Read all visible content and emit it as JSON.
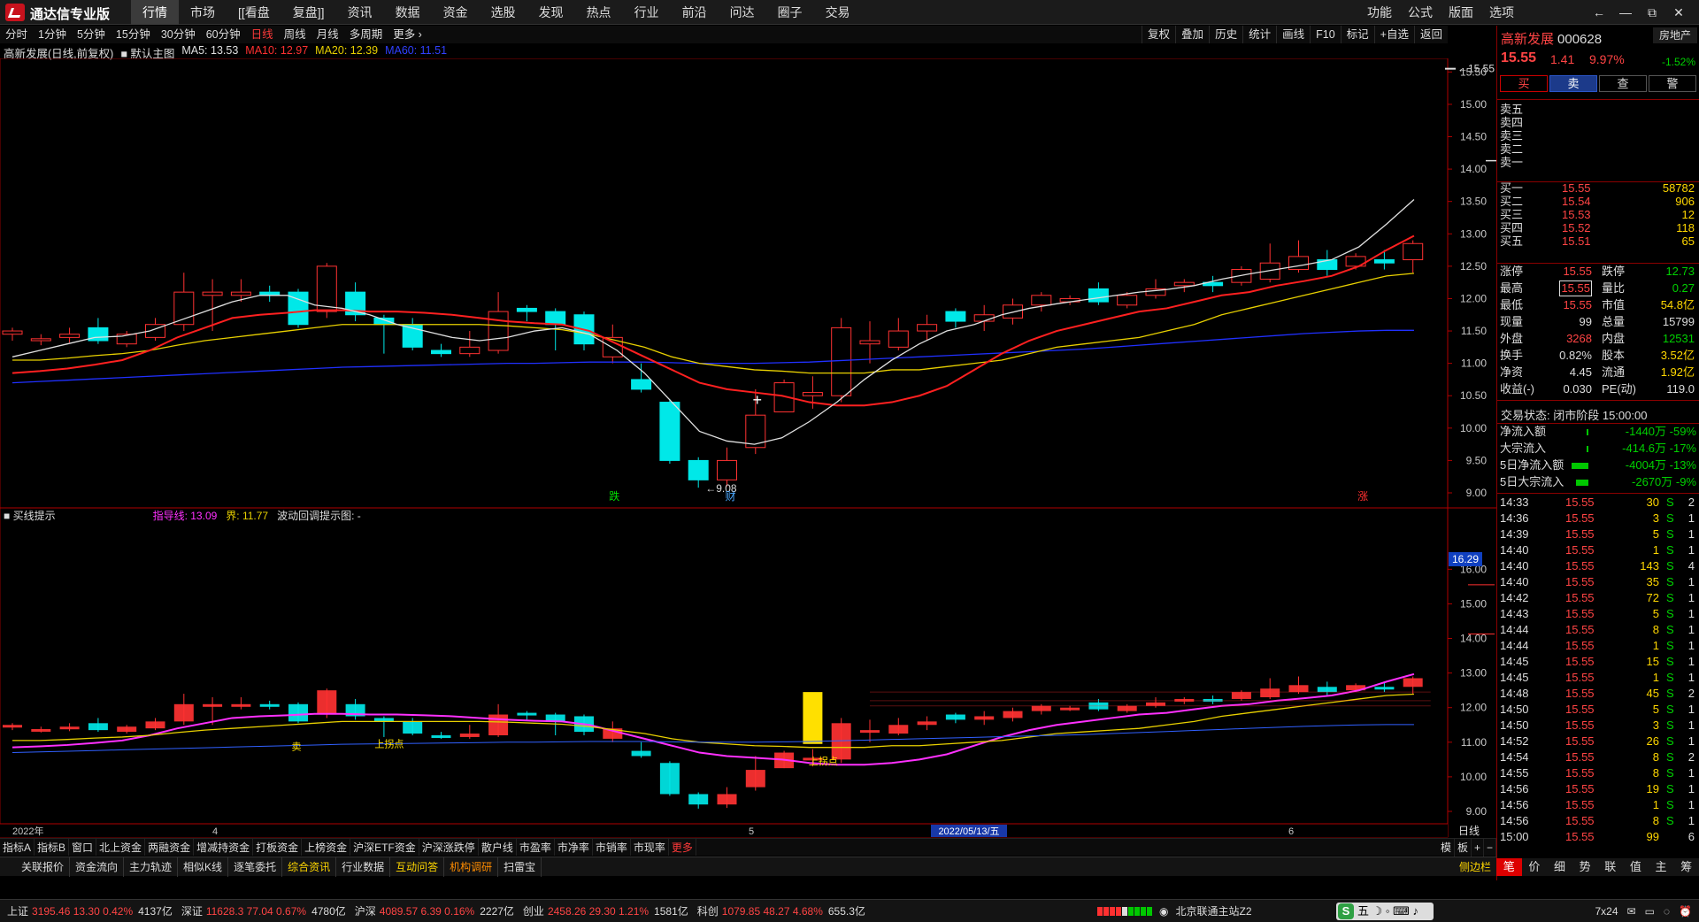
{
  "app": {
    "title": "通达信专业版"
  },
  "menu": [
    "行情",
    "市场",
    "[[看盘",
    "复盘]]",
    "资讯",
    "数据",
    "资金",
    "选股",
    "发现",
    "热点",
    "行业",
    "前沿",
    "问达",
    "圈子",
    "交易"
  ],
  "right_menu": [
    "功能",
    "公式",
    "版面",
    "选项"
  ],
  "window_controls": [
    "←",
    "—",
    "⧉",
    "✕"
  ],
  "periods": [
    "分时",
    "1分钟",
    "5分钟",
    "15分钟",
    "30分钟",
    "60分钟",
    "日线",
    "周线",
    "月线",
    "多周期",
    "更多 ›"
  ],
  "active_period": "日线",
  "chart_tools": [
    "复权",
    "叠加",
    "历史",
    "统计",
    "画线",
    "F10",
    "标记",
    "+自选",
    "返回"
  ],
  "info": {
    "name": "高新发展(日线,前复权)",
    "main": "■ 默认主图",
    "ma5": "MA5: 13.53",
    "ma10": "MA10: 12.97",
    "ma20": "MA20: 12.39",
    "ma60": "MA60: 11.51"
  },
  "indicator": {
    "name": "■ 买线提示",
    "guide": "指导线: 13.09",
    "bound": "界: 11.77",
    "wave": "波动回调提示图: -"
  },
  "chart_data": {
    "type": "candlestick",
    "title": "高新发展(日线,前复权)",
    "price_axis": {
      "ylim": [
        9.0,
        15.6
      ],
      "ticks": [
        "15.50",
        "15.00",
        "14.50",
        "14.00",
        "13.50",
        "13.00",
        "12.50",
        "12.00",
        "11.50",
        "11.00",
        "10.50",
        "10.00",
        "9.50",
        "9.00"
      ]
    },
    "indicator_axis": {
      "ylim": [
        9.0,
        16.29
      ],
      "ticks": [
        "16.00",
        "15.00",
        "14.00",
        "13.00",
        "12.00",
        "11.00",
        "10.00",
        "9.00"
      ],
      "current_label": "16.29"
    },
    "candles": [
      [
        11.45,
        11.5,
        11.35,
        11.55
      ],
      [
        11.35,
        11.38,
        11.28,
        11.45
      ],
      [
        11.4,
        11.45,
        11.32,
        11.55
      ],
      [
        11.55,
        11.35,
        11.3,
        11.7
      ],
      [
        11.3,
        11.45,
        11.25,
        11.5
      ],
      [
        11.4,
        11.6,
        11.35,
        11.7
      ],
      [
        11.6,
        12.1,
        11.5,
        12.4
      ],
      [
        12.05,
        12.1,
        11.5,
        12.3
      ],
      [
        12.05,
        12.1,
        11.95,
        12.3
      ],
      [
        12.1,
        12.05,
        11.95,
        12.2
      ],
      [
        12.1,
        11.6,
        11.55,
        12.15
      ],
      [
        11.8,
        12.5,
        11.7,
        12.55
      ],
      [
        12.1,
        11.75,
        11.65,
        12.25
      ],
      [
        11.7,
        11.6,
        11.15,
        11.75
      ],
      [
        11.6,
        11.25,
        11.2,
        11.7
      ],
      [
        11.2,
        11.15,
        11.1,
        11.3
      ],
      [
        11.15,
        11.25,
        11.1,
        11.5
      ],
      [
        11.2,
        11.8,
        11.15,
        12.1
      ],
      [
        11.85,
        11.8,
        11.65,
        11.9
      ],
      [
        11.8,
        11.6,
        11.2,
        11.85
      ],
      [
        11.75,
        11.3,
        11.2,
        11.8
      ],
      [
        11.1,
        11.4,
        11.0,
        11.6
      ],
      [
        10.75,
        10.6,
        10.55,
        11.0
      ],
      [
        10.4,
        9.5,
        9.45,
        10.45
      ],
      [
        9.5,
        9.2,
        9.08,
        9.55
      ],
      [
        9.2,
        9.5,
        9.1,
        9.7
      ],
      [
        9.7,
        10.2,
        9.6,
        10.6
      ],
      [
        10.25,
        10.7,
        10.25,
        10.75
      ],
      [
        10.5,
        10.55,
        10.3,
        10.8
      ],
      [
        10.5,
        11.55,
        10.4,
        11.7
      ],
      [
        11.3,
        11.35,
        11.0,
        11.65
      ],
      [
        11.25,
        11.5,
        11.2,
        11.7
      ],
      [
        11.5,
        11.6,
        11.35,
        11.75
      ],
      [
        11.8,
        11.65,
        11.55,
        11.85
      ],
      [
        11.65,
        11.75,
        11.5,
        11.9
      ],
      [
        11.7,
        11.9,
        11.6,
        12.0
      ],
      [
        11.9,
        12.05,
        11.8,
        12.1
      ],
      [
        11.95,
        12.0,
        11.9,
        12.05
      ],
      [
        12.15,
        11.95,
        11.9,
        12.25
      ],
      [
        11.9,
        12.05,
        11.85,
        12.1
      ],
      [
        12.05,
        12.15,
        12.0,
        12.3
      ],
      [
        12.2,
        12.25,
        12.1,
        12.3
      ],
      [
        12.25,
        12.2,
        12.1,
        12.35
      ],
      [
        12.25,
        12.45,
        12.2,
        12.5
      ],
      [
        12.3,
        12.55,
        12.25,
        12.85
      ],
      [
        12.45,
        12.65,
        12.4,
        12.9
      ],
      [
        12.6,
        12.45,
        12.35,
        12.75
      ],
      [
        12.5,
        12.65,
        12.45,
        12.7
      ],
      [
        12.6,
        12.55,
        12.45,
        12.75
      ],
      [
        12.6,
        12.85,
        12.4,
        12.9
      ]
    ],
    "ma5": [
      11.1,
      11.2,
      11.3,
      11.4,
      11.42,
      11.5,
      11.65,
      11.8,
      11.95,
      12.05,
      12.05,
      11.9,
      11.85,
      11.75,
      11.6,
      11.5,
      11.4,
      11.35,
      11.4,
      11.5,
      11.55,
      11.45,
      11.2,
      10.85,
      10.4,
      9.95,
      9.8,
      9.75,
      9.85,
      10.1,
      10.4,
      10.75,
      11.05,
      11.3,
      11.5,
      11.6,
      11.75,
      11.85,
      11.92,
      11.98,
      12.04,
      12.1,
      12.14,
      12.2,
      12.3,
      12.38,
      12.45,
      12.52,
      12.6,
      12.8,
      13.15,
      13.53
    ],
    "ma10": [
      10.85,
      10.88,
      10.92,
      10.98,
      11.05,
      11.2,
      11.4,
      11.55,
      11.7,
      11.75,
      11.78,
      11.82,
      11.82,
      11.8,
      11.8,
      11.78,
      11.75,
      11.7,
      11.65,
      11.62,
      11.6,
      11.5,
      11.3,
      11.1,
      10.9,
      10.7,
      10.6,
      10.55,
      10.5,
      10.4,
      10.35,
      10.35,
      10.4,
      10.5,
      10.65,
      10.9,
      11.15,
      11.35,
      11.5,
      11.6,
      11.7,
      11.8,
      11.85,
      11.95,
      12.05,
      12.1,
      12.2,
      12.27,
      12.35,
      12.5,
      12.75,
      12.97
    ],
    "ma20": [
      11.05,
      11.05,
      11.08,
      11.12,
      11.15,
      11.2,
      11.28,
      11.35,
      11.4,
      11.45,
      11.5,
      11.55,
      11.6,
      11.6,
      11.6,
      11.6,
      11.6,
      11.6,
      11.58,
      11.55,
      11.52,
      11.45,
      11.35,
      11.25,
      11.1,
      11.0,
      10.95,
      10.9,
      10.88,
      10.85,
      10.85,
      10.85,
      10.9,
      10.9,
      10.95,
      11.0,
      11.05,
      11.15,
      11.25,
      11.3,
      11.35,
      11.4,
      11.5,
      11.6,
      11.75,
      11.85,
      11.95,
      12.05,
      12.15,
      12.25,
      12.35,
      12.39
    ],
    "ma60": [
      10.7,
      10.72,
      10.74,
      10.76,
      10.78,
      10.8,
      10.82,
      10.84,
      10.86,
      10.88,
      10.9,
      10.92,
      10.94,
      10.95,
      10.96,
      10.97,
      10.98,
      10.99,
      11.0,
      11.0,
      11.01,
      11.02,
      11.02,
      11.02,
      11.01,
      11.0,
      11.0,
      11.0,
      11.01,
      11.02,
      11.04,
      11.06,
      11.08,
      11.1,
      11.12,
      11.14,
      11.16,
      11.18,
      11.2,
      11.22,
      11.25,
      11.28,
      11.31,
      11.34,
      11.37,
      11.4,
      11.43,
      11.46,
      11.48,
      11.5,
      11.51,
      11.51
    ],
    "price_labels": {
      "high": "15.55",
      "low": "9.08"
    },
    "annotations": [
      "跌",
      "财",
      "涨",
      "卖",
      "上拐点",
      "上拐点"
    ],
    "x_labels": [
      "2022年",
      "4",
      "5",
      "6"
    ],
    "cursor_date": "2022/05/13/五",
    "cursor_right": "日线"
  },
  "quote": {
    "name": "高新发展",
    "code": "000628",
    "sector": "房地产",
    "sector_pct": "-1.52%",
    "price": "15.55",
    "change": "1.41",
    "pct": "9.97%",
    "buttons": [
      "买",
      "卖",
      "查",
      "警"
    ],
    "asks": [
      {
        "l": "卖五",
        "p": "",
        "v": ""
      },
      {
        "l": "卖四",
        "p": "",
        "v": ""
      },
      {
        "l": "卖三",
        "p": "",
        "v": ""
      },
      {
        "l": "卖二",
        "p": "",
        "v": ""
      },
      {
        "l": "卖一",
        "p": "",
        "v": ""
      }
    ],
    "bids": [
      {
        "l": "买一",
        "p": "15.55",
        "v": "58782"
      },
      {
        "l": "买二",
        "p": "15.54",
        "v": "906"
      },
      {
        "l": "买三",
        "p": "15.53",
        "v": "12"
      },
      {
        "l": "买四",
        "p": "15.52",
        "v": "118"
      },
      {
        "l": "买五",
        "p": "15.51",
        "v": "65"
      }
    ],
    "stats": [
      {
        "a": "涨停",
        "b": "15.55",
        "c": "跌停",
        "d": "12.73"
      },
      {
        "a": "最高",
        "b": "15.55",
        "c": "量比",
        "d": "0.27"
      },
      {
        "a": "最低",
        "b": "15.55",
        "c": "市值",
        "d": "54.8亿"
      },
      {
        "a": "现量",
        "b": "99",
        "c": "总量",
        "d": "15799"
      },
      {
        "a": "外盘",
        "b": "3268",
        "c": "内盘",
        "d": "12531"
      },
      {
        "a": "换手",
        "b": "0.82%",
        "c": "股本",
        "d": "3.52亿"
      },
      {
        "a": "净资",
        "b": "4.45",
        "c": "流通",
        "d": "1.92亿"
      },
      {
        "a": "收益(-)",
        "b": "0.030",
        "c": "PE(动)",
        "d": "119.0"
      }
    ],
    "trade_state": "交易状态: 闭市阶段 15:00:00",
    "flows": [
      {
        "a": "净流入额",
        "v": "-1440万 -59%",
        "w": 0.08
      },
      {
        "a": "大宗流入",
        "v": "-414.6万 -17%",
        "w": 0.03
      },
      {
        "a": "5日净流入额",
        "v": "-4004万 -13%",
        "w": 0.95
      },
      {
        "a": "5日大宗流入",
        "v": "-2670万 -9%",
        "w": 0.7
      }
    ],
    "ticks": [
      [
        "14:33",
        "15.55",
        "30",
        "S",
        "2"
      ],
      [
        "14:36",
        "15.55",
        "3",
        "S",
        "1"
      ],
      [
        "14:39",
        "15.55",
        "5",
        "S",
        "1"
      ],
      [
        "14:40",
        "15.55",
        "1",
        "S",
        "1"
      ],
      [
        "14:40",
        "15.55",
        "143",
        "S",
        "4"
      ],
      [
        "14:40",
        "15.55",
        "35",
        "S",
        "1"
      ],
      [
        "14:42",
        "15.55",
        "72",
        "S",
        "1"
      ],
      [
        "14:43",
        "15.55",
        "5",
        "S",
        "1"
      ],
      [
        "14:44",
        "15.55",
        "8",
        "S",
        "1"
      ],
      [
        "14:44",
        "15.55",
        "1",
        "S",
        "1"
      ],
      [
        "14:45",
        "15.55",
        "15",
        "S",
        "1"
      ],
      [
        "14:45",
        "15.55",
        "1",
        "S",
        "1"
      ],
      [
        "14:48",
        "15.55",
        "45",
        "S",
        "2"
      ],
      [
        "14:50",
        "15.55",
        "5",
        "S",
        "1"
      ],
      [
        "14:50",
        "15.55",
        "3",
        "S",
        "1"
      ],
      [
        "14:52",
        "15.55",
        "26",
        "S",
        "1"
      ],
      [
        "14:54",
        "15.55",
        "8",
        "S",
        "2"
      ],
      [
        "14:55",
        "15.55",
        "8",
        "S",
        "1"
      ],
      [
        "14:56",
        "15.55",
        "19",
        "S",
        "1"
      ],
      [
        "14:56",
        "15.55",
        "1",
        "S",
        "1"
      ],
      [
        "14:56",
        "15.55",
        "8",
        "S",
        "1"
      ],
      [
        "15:00",
        "15.55",
        "99",
        "",
        "6"
      ]
    ]
  },
  "tabs1": [
    "指标A",
    "指标B",
    "窗口",
    "北上资金",
    "两融资金",
    "增减持资金",
    "打板资金",
    "上榜资金",
    "沪深ETF资金",
    "沪深涨跌停",
    "散户线",
    "市盈率",
    "市净率",
    "市销率",
    "市现率",
    "更多"
  ],
  "tabs1_right": [
    "模",
    "板",
    "+",
    "−"
  ],
  "tabs2": [
    "关联报价",
    "资金流向",
    "主力轨迹",
    "相似K线",
    "逐笔委托",
    "综合资讯",
    "行业数据",
    "互动问答",
    "机构调研",
    "扫雷宝"
  ],
  "tabs2_side": "侧边栏",
  "rtabs": [
    "笔",
    "价",
    "细",
    "势",
    "联",
    "值",
    "主",
    "筹"
  ],
  "status": {
    "indices": [
      {
        "nm": "上证",
        "v": "3195.46  13.30  0.42%",
        "amt": "4137亿"
      },
      {
        "nm": "深证",
        "v": "11628.3  77.04  0.67%",
        "amt": "4780亿"
      },
      {
        "nm": "沪深",
        "v": "4089.57  6.39  0.16%",
        "amt": "2227亿"
      },
      {
        "nm": "创业",
        "v": "2458.26  29.30  1.21%",
        "amt": "1581亿"
      },
      {
        "nm": "科创",
        "v": "1079.85  48.27  4.68%",
        "amt": "655.3亿"
      }
    ],
    "server": "北京联通主站Z2",
    "ime": "五",
    "session": "7x24"
  },
  "colors": {
    "up": "#ff3232",
    "down": "#00e8e8",
    "ma5": "#e0e0e0",
    "ma10": "#ff2020",
    "ma20": "#e8d000",
    "ma60": "#2030ff",
    "guide": "#ff30ff"
  }
}
